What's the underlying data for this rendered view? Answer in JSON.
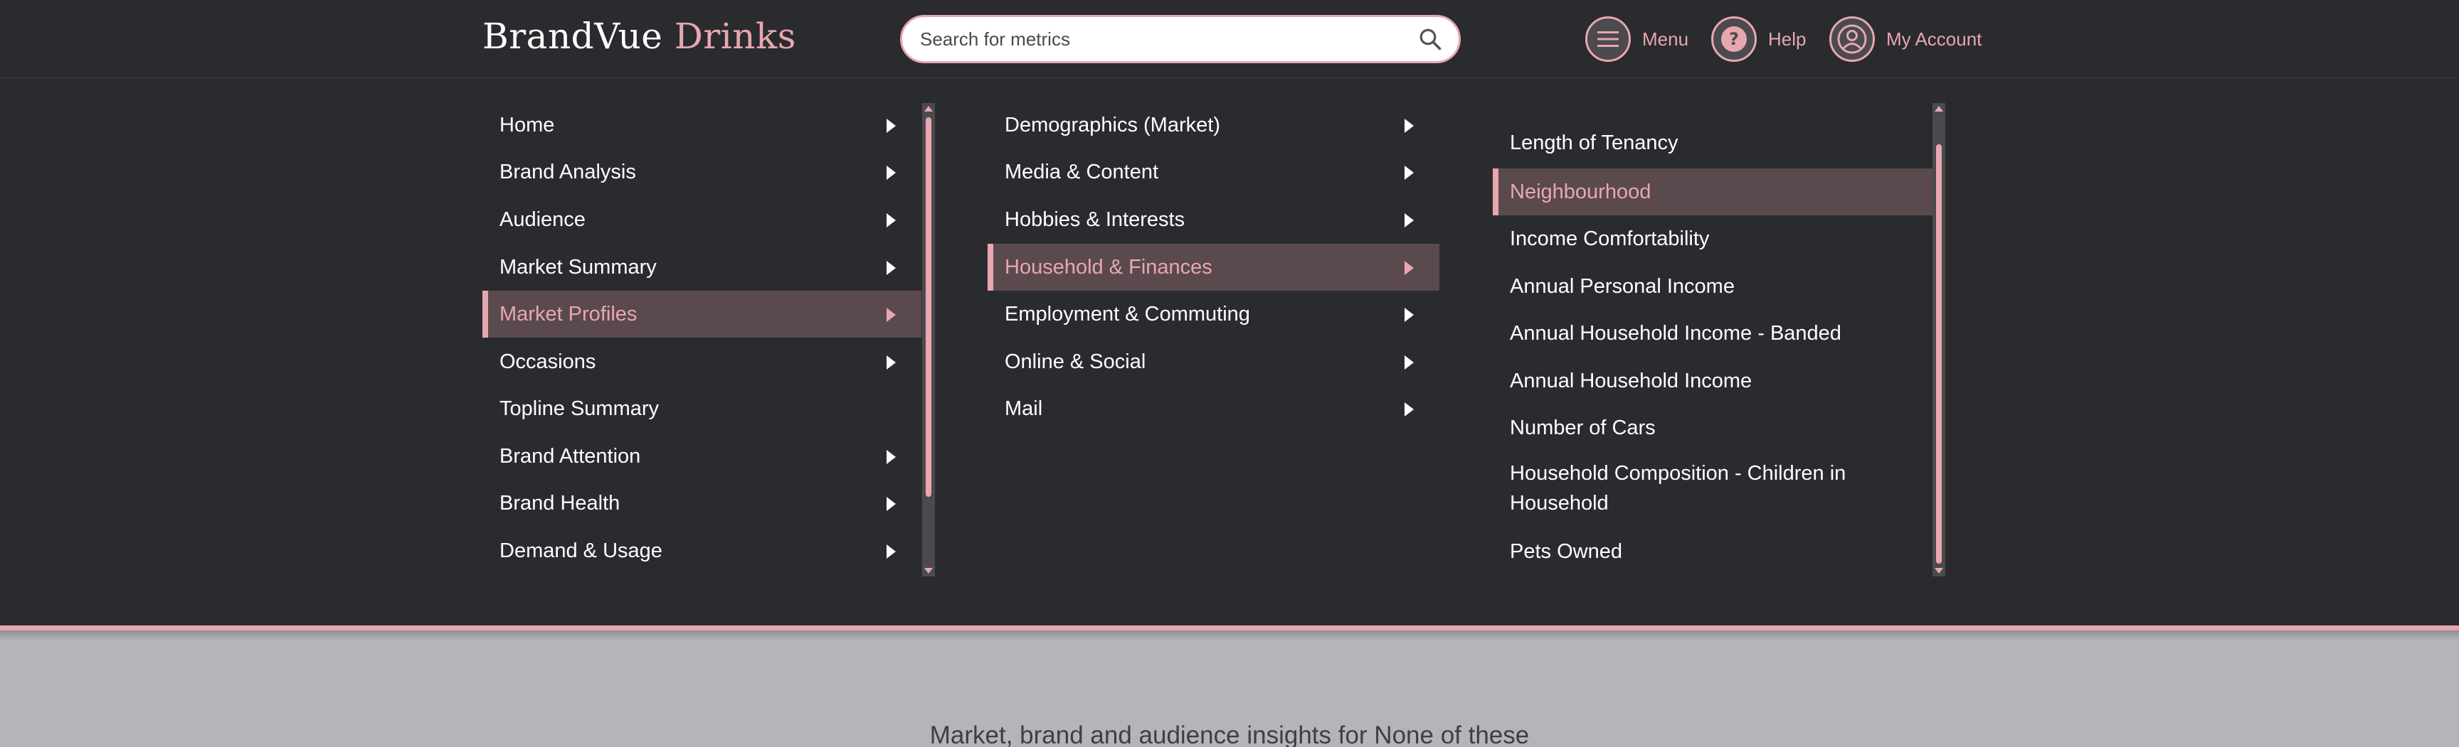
{
  "header": {
    "brand_primary": "BrandVue",
    "brand_accent": "Drinks",
    "search_placeholder": "Search for metrics",
    "menu_label": "Menu",
    "help_label": "Help",
    "account_label": "My Account"
  },
  "colors": {
    "accent": "#e8a7ae",
    "panel_bg": "#2a2b2f",
    "selected_bg": "#5a4a4e",
    "page_bg": "#b3b5ba"
  },
  "menu": {
    "level1": [
      {
        "label": "Home",
        "has_children": true
      },
      {
        "label": "Brand Analysis",
        "has_children": true
      },
      {
        "label": "Audience",
        "has_children": true
      },
      {
        "label": "Market Summary",
        "has_children": true
      },
      {
        "label": "Market Profiles",
        "has_children": true,
        "selected": true
      },
      {
        "label": "Occasions",
        "has_children": true
      },
      {
        "label": "Topline Summary",
        "has_children": false
      },
      {
        "label": "Brand Attention",
        "has_children": true
      },
      {
        "label": "Brand Health",
        "has_children": true
      },
      {
        "label": "Demand & Usage",
        "has_children": true
      }
    ],
    "level2": [
      {
        "label": "Demographics (Market)",
        "has_children": true
      },
      {
        "label": "Media & Content",
        "has_children": true
      },
      {
        "label": "Hobbies & Interests",
        "has_children": true
      },
      {
        "label": "Household & Finances",
        "has_children": true,
        "selected": true
      },
      {
        "label": "Employment & Commuting",
        "has_children": true
      },
      {
        "label": "Online & Social",
        "has_children": true
      },
      {
        "label": "Mail",
        "has_children": true
      }
    ],
    "level3": [
      {
        "label": "Length of Tenancy"
      },
      {
        "label": "Neighbourhood",
        "selected": true
      },
      {
        "label": "Income Comfortability"
      },
      {
        "label": "Annual Personal Income"
      },
      {
        "label": "Annual Household Income - Banded"
      },
      {
        "label": "Annual Household Income"
      },
      {
        "label": "Number of Cars"
      },
      {
        "label": "Household Composition - Children in Household"
      },
      {
        "label": "Pets Owned"
      }
    ]
  },
  "tagline": "Market, brand and audience insights for None of these"
}
